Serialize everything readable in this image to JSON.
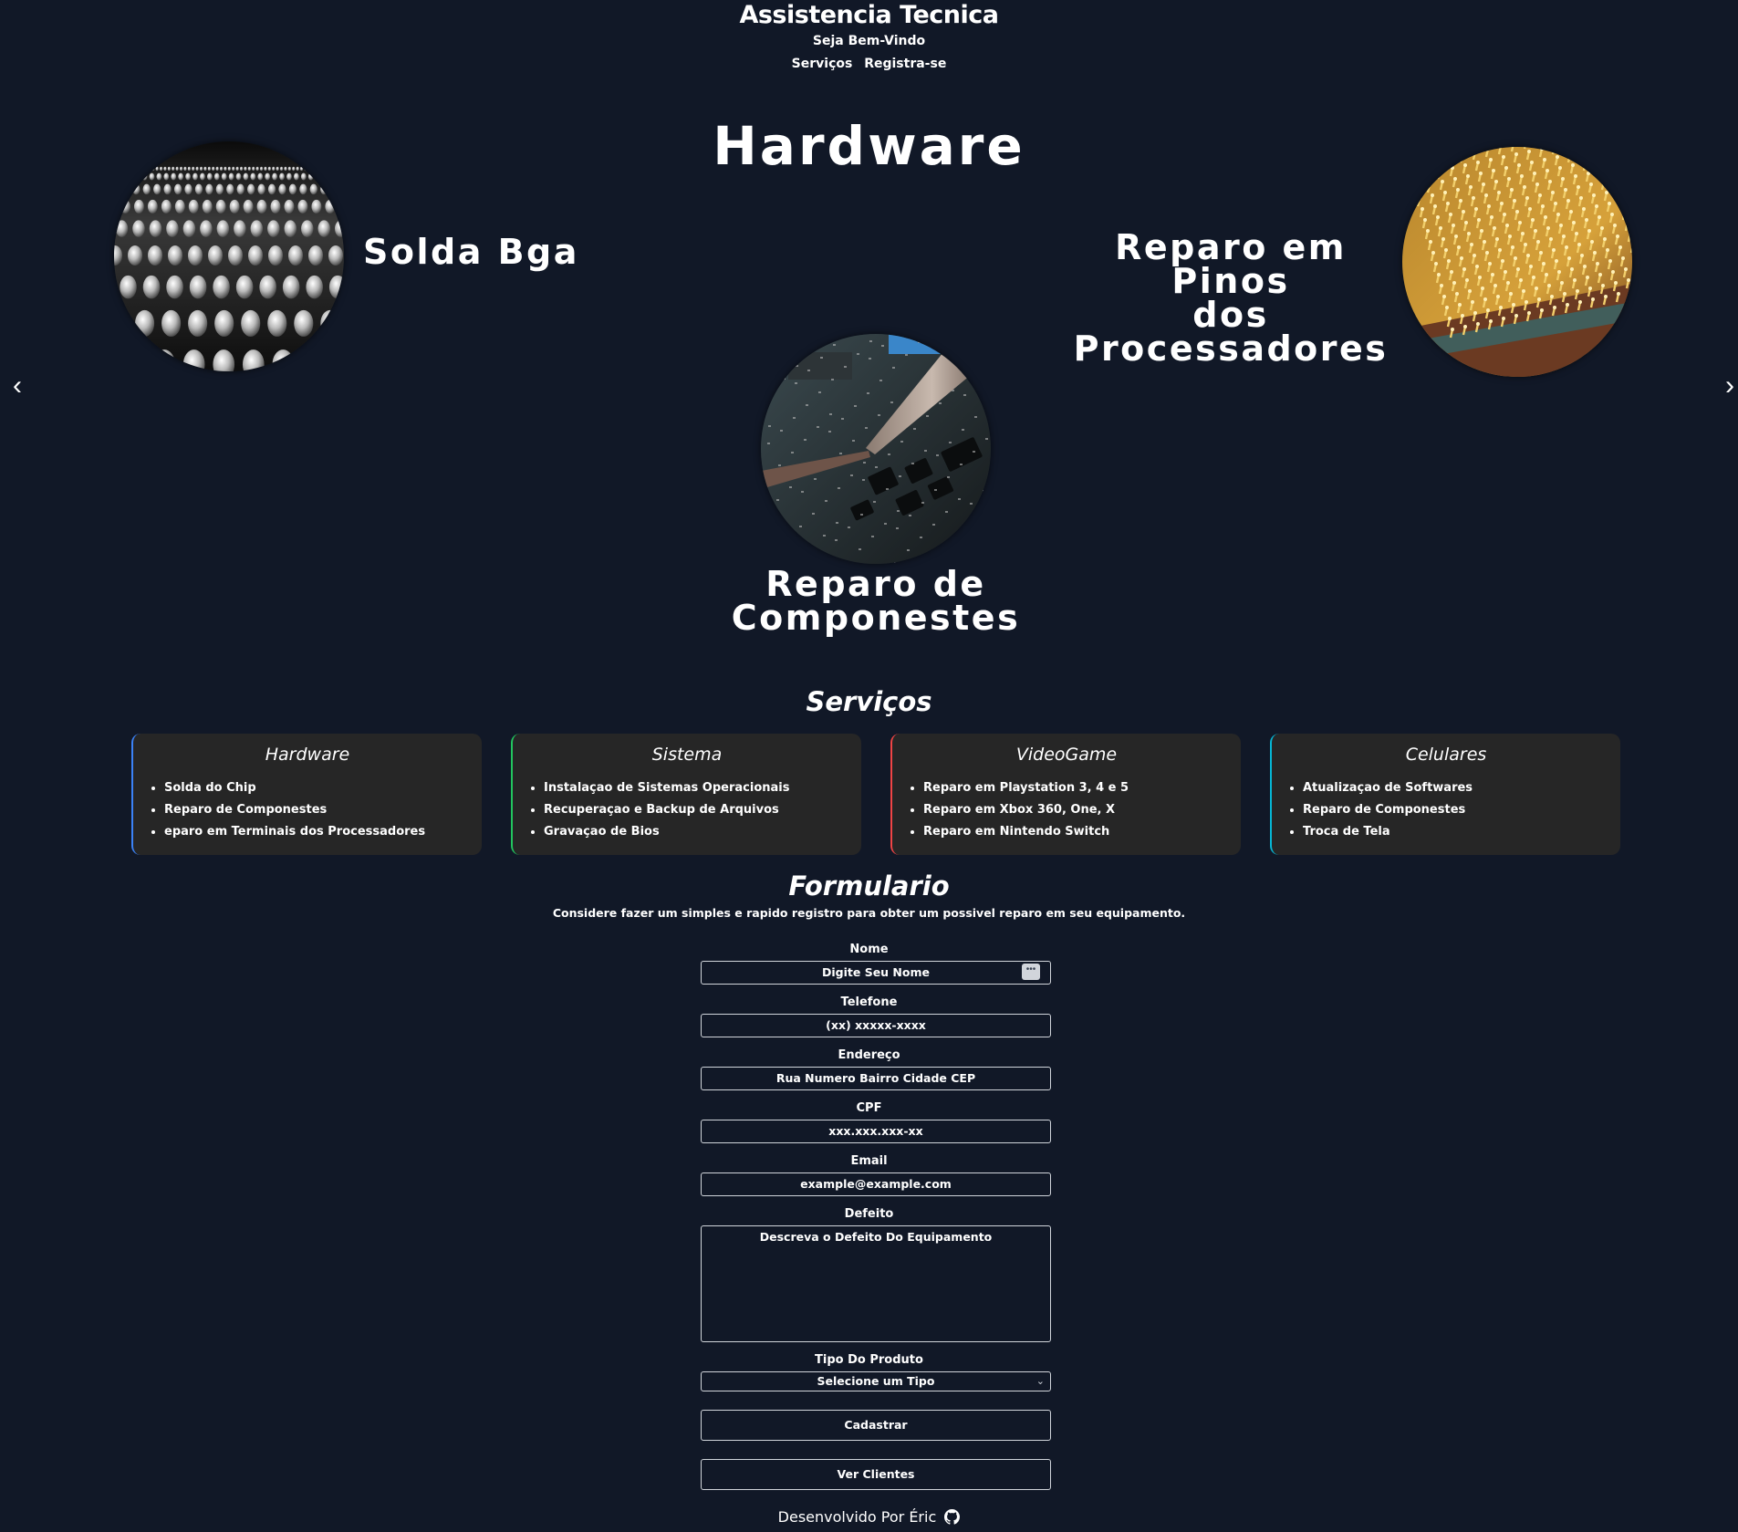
{
  "header": {
    "title": "Assistencia Tecnica",
    "welcome": "Seja Bem-Vindo",
    "nav": [
      "Serviços",
      "Registra-se"
    ]
  },
  "carousel": {
    "heading": "Hardware",
    "prev_icon": "chevron-left-icon",
    "next_icon": "chevron-right-icon",
    "prev_glyph": "‹",
    "next_glyph": "›",
    "slides": [
      {
        "caption": "Solda Bga",
        "image": "bga-solder-balls-photo"
      },
      {
        "caption_line1": "Reparo em Pinos",
        "caption_line2": "dos Processadores",
        "image": "processor-pins-photo"
      },
      {
        "caption_line1": "Reparo de",
        "caption_line2": "Componestes",
        "image": "soldering-iron-circuit-photo"
      }
    ]
  },
  "services": {
    "title": "Serviços",
    "cards": [
      {
        "title": "Hardware",
        "accent": "#3b82f6",
        "items": [
          "Solda do Chip",
          "Reparo de Componestes",
          "eparo em Terminais dos Processadores"
        ]
      },
      {
        "title": "Sistema",
        "accent": "#22c55e",
        "items": [
          "Instalaçao de Sistemas Operacionais",
          "Recuperaçao e Backup de Arquivos",
          "Gravaçao de Bios"
        ]
      },
      {
        "title": "VideoGame",
        "accent": "#ef4444",
        "items": [
          "Reparo em Playstation 3, 4 e 5",
          "Reparo em Xbox 360, One, X",
          "Reparo em Nintendo Switch"
        ]
      },
      {
        "title": "Celulares",
        "accent": "#06b6d4",
        "items": [
          "Atualizaçao de Softwares",
          "Reparo de Componestes",
          "Troca de Tela"
        ]
      }
    ]
  },
  "form": {
    "title": "Formulario",
    "description": "Considere fazer um simples e rapido registro para obter um possivel reparo em seu equipamento.",
    "fields": {
      "name": {
        "label": "Nome",
        "placeholder": "Digite Seu Nome"
      },
      "phone": {
        "label": "Telefone",
        "placeholder": "(xx) xxxxx-xxxx"
      },
      "address": {
        "label": "Endereço",
        "placeholder": "Rua Numero Bairro Cidade CEP"
      },
      "cpf": {
        "label": "CPF",
        "placeholder": "xxx.xxx.xxx-xx"
      },
      "email": {
        "label": "Email",
        "placeholder": "example@example.com"
      },
      "defect": {
        "label": "Defeito",
        "placeholder": "Descreva o Defeito Do Equipamento"
      },
      "product_type": {
        "label": "Tipo Do Produto",
        "selected": "Selecione um Tipo"
      }
    },
    "submit_label": "Cadastrar",
    "clients_label": "Ver Clientes"
  },
  "footer": {
    "text": "Desenvolvido Por Éric",
    "icon": "github-icon"
  }
}
